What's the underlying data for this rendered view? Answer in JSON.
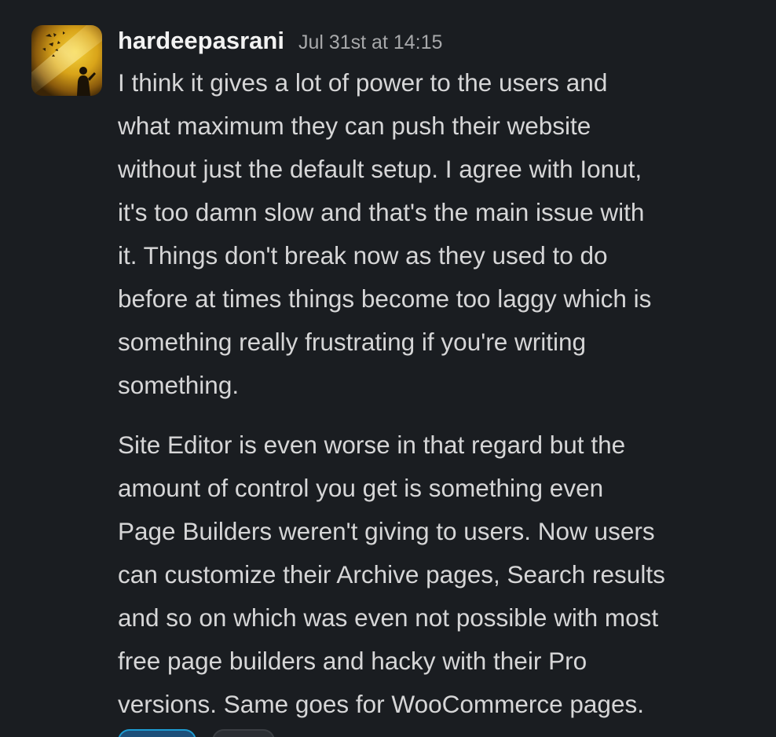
{
  "message": {
    "sender": "hardeepasrani",
    "timestamp": "Jul 31st at 14:15",
    "avatar_icon": "user-avatar-photo",
    "paragraphs": [
      {
        "lines": [
          "I think it gives a lot of power to the users and",
          "what maximum they can push their website",
          "without just the default setup. I agree with Ionut,",
          "it's too damn slow and that's the main issue with",
          "it. Things don't break now as they used to do",
          "before at times things become too laggy which is",
          "something really frustrating if you're writing",
          "something."
        ]
      },
      {
        "lines": [
          "Site Editor is even worse in that regard but the",
          "amount of control you get is something even",
          "Page Builders weren't giving to users. Now users",
          "can customize their Archive pages, Search results",
          "and so on which was even not possible with most",
          "free page builders and hacky with their Pro",
          "versions. Same goes for WooCommerce pages."
        ]
      }
    ]
  },
  "colors": {
    "background": "#1a1d21",
    "sender_text": "#f2f2f2",
    "body_text": "#d6d6d7",
    "timestamp_text": "#a8a9ab",
    "reaction_active_border": "#1d9bd1"
  }
}
